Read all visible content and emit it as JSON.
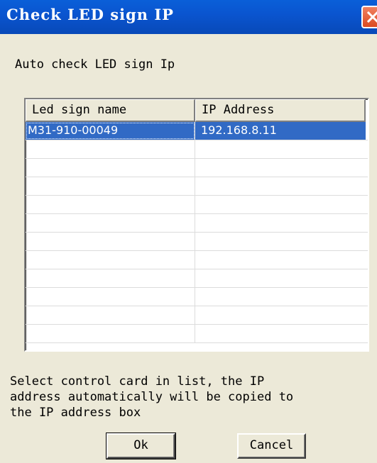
{
  "window": {
    "title": "Check LED sign IP",
    "close_icon": "close-icon"
  },
  "heading": "Auto check LED sign Ip",
  "list": {
    "columns": [
      "Led sign name",
      "IP Address"
    ],
    "rows": [
      [
        "M31-910-00049",
        "192.168.8.11"
      ],
      [
        "",
        ""
      ],
      [
        "",
        ""
      ],
      [
        "",
        ""
      ],
      [
        "",
        ""
      ],
      [
        "",
        ""
      ],
      [
        "",
        ""
      ],
      [
        "",
        ""
      ],
      [
        "",
        ""
      ],
      [
        "",
        ""
      ],
      [
        "",
        ""
      ],
      [
        "",
        ""
      ]
    ],
    "selected_index": 0
  },
  "instructions": "Select control card in list, the IP\naddress automatically will be copied to\nthe IP address box",
  "buttons": {
    "ok": "Ok",
    "cancel": "Cancel"
  },
  "colors": {
    "titlebar": "#0a55d0",
    "selection": "#316ac5",
    "close": "#dc4a20",
    "face": "#ece9d8"
  }
}
